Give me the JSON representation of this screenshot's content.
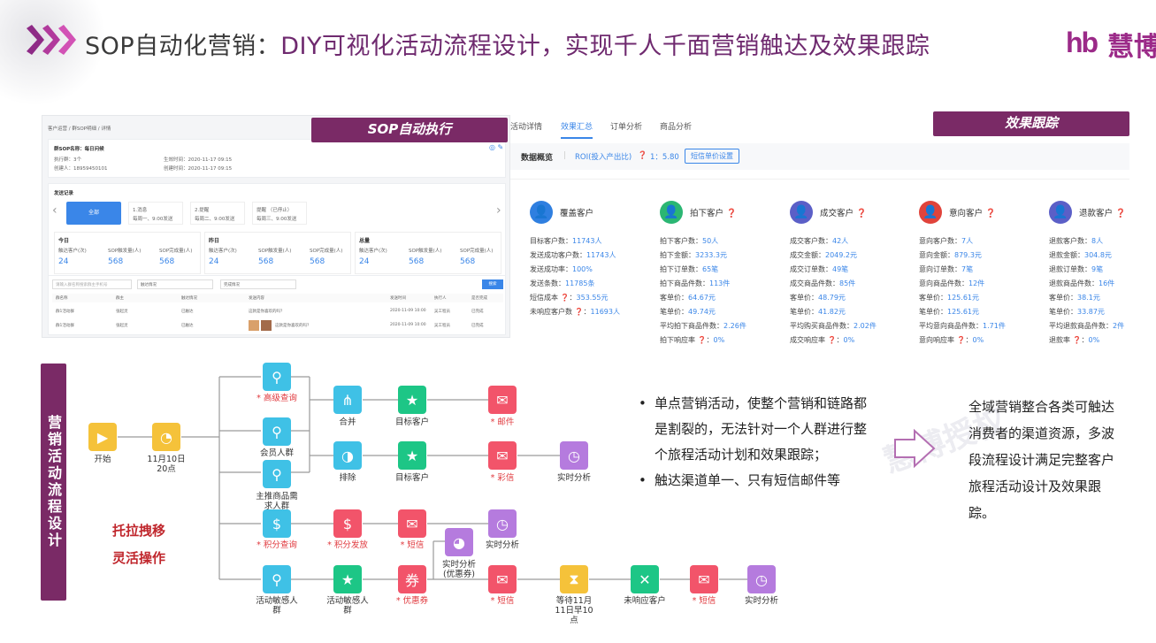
{
  "header": {
    "title_prefix": "SOP自动化营销：",
    "title_accent": "DIY可视化活动流程设计，实现千人千面营销触达及效果跟踪",
    "logo_mark": "hb",
    "logo_text": "慧博"
  },
  "banners": {
    "sop": "SOP自动执行",
    "effect": "效果跟踪"
  },
  "left_shot": {
    "breadcrumb": "客户运营 / 群SOP明细 / 详情",
    "sop_name": "群SOP名称：每日问候",
    "fields": [
      "执行群：3个",
      "创建人：18959450101",
      "生效时间：2020-11-17 09:15",
      "创建时间：2020-11-17 09:15"
    ],
    "section": "发送记录",
    "tab_all": "全部",
    "tabs": [
      {
        "name": "1.消息",
        "desc": "每周一、9:00发送"
      },
      {
        "name": "2.提醒",
        "desc": "每周二、9:00发送"
      },
      {
        "name": "提醒 （已停止）",
        "desc": "每周三、9:00发送"
      }
    ],
    "periods": [
      {
        "name": "今日",
        "labels": [
          "触达客户(次)",
          "SOP触发量(人)",
          "SOP完成量(人)"
        ],
        "values": [
          "24",
          "568",
          "568"
        ]
      },
      {
        "name": "昨日",
        "labels": [
          "触达客户(次)",
          "SOP触发量(人)",
          "SOP完成量(人)"
        ],
        "values": [
          "24",
          "568",
          "568"
        ]
      },
      {
        "name": "总量",
        "labels": [
          "触达客户(次)",
          "SOP触发量(人)",
          "SOP完成量(人)"
        ],
        "values": [
          "24",
          "568",
          "568"
        ]
      }
    ],
    "search_placeholder": "请输入群名称搜索群主手机号",
    "filter1": "触达情况",
    "filter2": "完成情况",
    "search_btn": "搜索",
    "table_headers": [
      "群名称",
      "群主",
      "触达情况",
      "发送内容",
      "发送时间",
      "执行人",
      "是否完成"
    ],
    "rows": [
      [
        "群1活动群",
        "张起灵",
        "已触达",
        "这款是你喜欢的吗？",
        "2020-11-09 10:00",
        "吴工程员",
        "已完成"
      ],
      [
        "群1活动群",
        "张起灵",
        "已触达",
        "这款是你喜欢的吗？",
        "2020-11-09 10:00",
        "吴工程员",
        "已完成"
      ]
    ]
  },
  "right_shot": {
    "tabs": [
      "活动详情",
      "效果汇总",
      "订单分析",
      "商品分析"
    ],
    "overview_label": "数据概览",
    "roi_label": "ROI(投入产出比)",
    "roi_value": "1：5.80",
    "price_btn": "短信单价设置",
    "columns": [
      {
        "title": "覆盖客户",
        "color": "#2f7fe0",
        "rows": [
          [
            "目标客户数：",
            "11743人"
          ],
          [
            "发送成功客户数：",
            "11743人"
          ],
          [
            "发送成功率：",
            "100%"
          ],
          [
            "发送条数：",
            "11785条"
          ],
          [
            "短信成本 ❓：",
            "353.55元"
          ],
          [
            "未响应客户数 ❓：",
            "11693人"
          ]
        ]
      },
      {
        "title": "拍下客户 ❓",
        "color": "#2bb673",
        "rows": [
          [
            "拍下客户数：",
            "50人"
          ],
          [
            "拍下金额：",
            "3233.3元"
          ],
          [
            "拍下订单数：",
            "65笔"
          ],
          [
            "拍下商品件数：",
            "113件"
          ],
          [
            "客单价：",
            "64.67元"
          ],
          [
            "笔单价：",
            "49.74元"
          ],
          [
            "平均拍下商品件数：",
            "2.26件"
          ],
          [
            "拍下响应率 ❓：",
            "0%"
          ]
        ]
      },
      {
        "title": "成交客户 ❓",
        "color": "#5b5fc7",
        "rows": [
          [
            "成交客户数：",
            "42人"
          ],
          [
            "成交金额：",
            "2049.2元"
          ],
          [
            "成交订单数：",
            "49笔"
          ],
          [
            "成交商品件数：",
            "85件"
          ],
          [
            "客单价：",
            "48.79元"
          ],
          [
            "笔单价：",
            "41.82元"
          ],
          [
            "平均购买商品件数：",
            "2.02件"
          ],
          [
            "成交响应率 ❓：",
            "0%"
          ]
        ]
      },
      {
        "title": "意向客户 ❓",
        "color": "#e0433b",
        "rows": [
          [
            "意向客户数：",
            "7人"
          ],
          [
            "意向金额：",
            "879.3元"
          ],
          [
            "意向订单数：",
            "7笔"
          ],
          [
            "意向商品件数：",
            "12件"
          ],
          [
            "客单价：",
            "125.61元"
          ],
          [
            "笔单价：",
            "125.61元"
          ],
          [
            "平均意向商品件数：",
            "1.71件"
          ],
          [
            "意向响应率 ❓：",
            "0%"
          ]
        ]
      },
      {
        "title": "退款客户 ❓",
        "color": "#5b5fc7",
        "rows": [
          [
            "退款客户数：",
            "8人"
          ],
          [
            "退款金额：",
            "304.8元"
          ],
          [
            "退款订单数：",
            "9笔"
          ],
          [
            "退款商品件数：",
            "16件"
          ],
          [
            "客单价：",
            "38.1元"
          ],
          [
            "笔单价：",
            "33.87元"
          ],
          [
            "平均退款商品件数：",
            "2件"
          ],
          [
            "退款率 ❓：",
            "0%"
          ]
        ]
      }
    ]
  },
  "flow": {
    "side_title": "营销活动流程设计",
    "drag_line1": "托拉拽移",
    "drag_line2": "灵活操作",
    "nodes": {
      "start": "开始",
      "time": "11月10日\n20点",
      "adv_query": "* 高级查询",
      "member": "会员人群",
      "main_product": "主推商品需\n求人群",
      "points_query": "* 积分查询",
      "sensitive1": "活动敏感人\n群",
      "merge": "合并",
      "exclude": "排除",
      "points_issue": "* 积分发放",
      "sensitive2": "活动敏感人\n群",
      "target1": "目标客户",
      "target2": "目标客户",
      "sms1": "* 短信",
      "coupon": "* 优惠券",
      "email1": "* 邮件",
      "mms": "* 彩信",
      "realtime_coupon": "实时分析\n(优惠券)",
      "sms2": "* 短信",
      "realtime1": "实时分析",
      "realtime2": "实时分析",
      "wait": "等待11月\n11日早10\n点",
      "no_response": "未响应客户",
      "sms3": "* 短信",
      "realtime3": "实时分析"
    }
  },
  "bullets": [
    "单点营销活动，使整个营销和链路都是割裂的，无法针对一个人群进行整个旅程活动计划和效果跟踪；",
    "触达渠道单一、只有短信邮件等"
  ],
  "summary": "全域营销整合各类可触达消费者的渠道资源，多波段流程设计满足完整客户旅程活动设计及效果跟踪。",
  "watermark": "慧博授权",
  "colors": {
    "brand": "#7a2a66",
    "blue": "#3a86e8",
    "pink": "#f2546a",
    "green": "#1dc686",
    "teal": "#3fc1e6",
    "purple": "#b57bde",
    "yellow": "#f5c23a"
  }
}
